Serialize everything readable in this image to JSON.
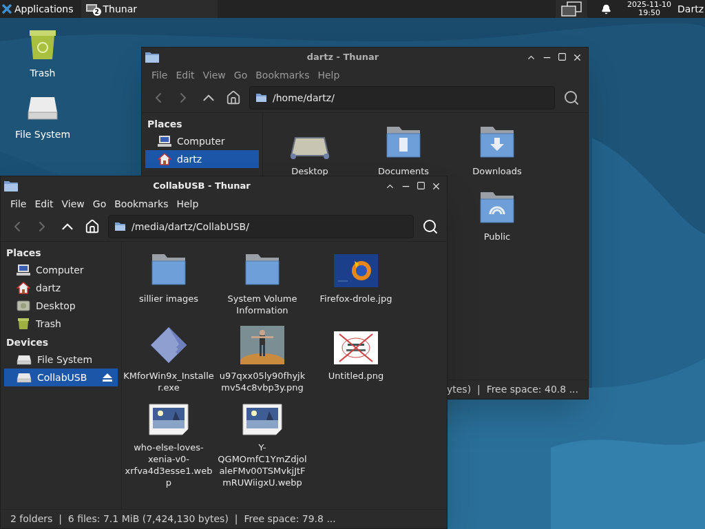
{
  "taskbar": {
    "apps_label": "Applications",
    "tasks": [
      {
        "label": "Thunar",
        "badge": "2",
        "selected": false
      }
    ],
    "date": "2025-11-10",
    "time": "19:50",
    "user": "Dartz"
  },
  "desktop_icons": [
    {
      "label": "Trash",
      "kind": "trash"
    },
    {
      "label": "File System",
      "kind": "drive"
    }
  ],
  "back_window": {
    "title": "dartz - Thunar",
    "menu": [
      "File",
      "Edit",
      "View",
      "Go",
      "Bookmarks",
      "Help"
    ],
    "back_disabled": true,
    "forward_disabled": true,
    "path": "/home/dartz/",
    "sections": [
      {
        "header": "Places",
        "items": [
          {
            "label": "Computer",
            "kind": "computer",
            "selected": false
          },
          {
            "label": "dartz",
            "kind": "home",
            "selected": true
          }
        ]
      }
    ],
    "files": [
      {
        "name": "Desktop",
        "kind": "desktop"
      },
      {
        "name": "Documents",
        "kind": "documents"
      },
      {
        "name": "Downloads",
        "kind": "downloads"
      },
      {
        "name": "Public",
        "kind": "public"
      }
    ],
    "status": "ytes)  |  Free space: 40.8 ..."
  },
  "front_window": {
    "title": "CollabUSB - Thunar",
    "menu": [
      "File",
      "Edit",
      "View",
      "Go",
      "Bookmarks",
      "Help"
    ],
    "back_disabled": true,
    "forward_disabled": true,
    "path": "/media/dartz/CollabUSB/",
    "sections": [
      {
        "header": "Places",
        "items": [
          {
            "label": "Computer",
            "kind": "computer",
            "selected": false
          },
          {
            "label": "dartz",
            "kind": "home",
            "selected": false
          },
          {
            "label": "Desktop",
            "kind": "desktop",
            "selected": false
          },
          {
            "label": "Trash",
            "kind": "trash",
            "selected": false
          }
        ]
      },
      {
        "header": "Devices",
        "items": [
          {
            "label": "File System",
            "kind": "drive",
            "selected": false
          },
          {
            "label": "CollabUSB",
            "kind": "drive",
            "selected": true,
            "eject": true
          }
        ]
      }
    ],
    "files": [
      {
        "name": "sillier images",
        "kind": "folder"
      },
      {
        "name": "System Volume Information",
        "kind": "folder"
      },
      {
        "name": "Firefox-drole.jpg",
        "kind": "photo-fox"
      },
      {
        "name": "KMforWin9x_Installer.exe",
        "kind": "installer"
      },
      {
        "name": "u97qxx05ly90fhyjkmv54c8vbp3y.png",
        "kind": "photo-figure"
      },
      {
        "name": "Untitled.png",
        "kind": "photo-crossed"
      },
      {
        "name": "who-else-loves-xenia-v0-xrfva4d3esse1.webp",
        "kind": "image-file"
      },
      {
        "name": "Y-QGMOmfC1YmZdjolaleFMv00TSMvkjJtFmRUWiigxU.webp",
        "kind": "image-file"
      }
    ],
    "status": "2 folders  |  6 files: 7.1 MiB (7,424,130 bytes)  |  Free space: 79.8 ..."
  }
}
